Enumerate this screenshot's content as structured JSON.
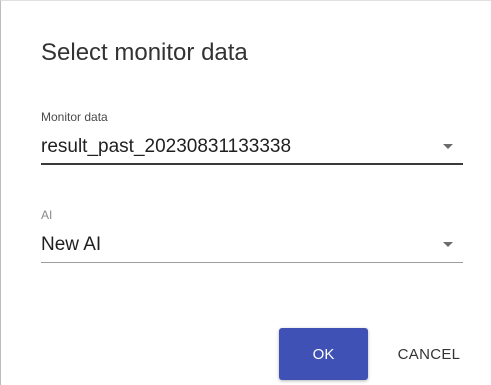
{
  "dialog": {
    "title": "Select monitor data"
  },
  "fields": {
    "monitor_data": {
      "label": "Monitor data",
      "value": "result_past_20230831133338"
    },
    "ai": {
      "label": "AI",
      "value": "New AI"
    }
  },
  "actions": {
    "ok_label": "OK",
    "cancel_label": "CANCEL"
  },
  "colors": {
    "primary": "#3f51b5",
    "text": "#1f1f1f"
  },
  "icons": {
    "dropdown": "dropdown-arrow-icon"
  }
}
